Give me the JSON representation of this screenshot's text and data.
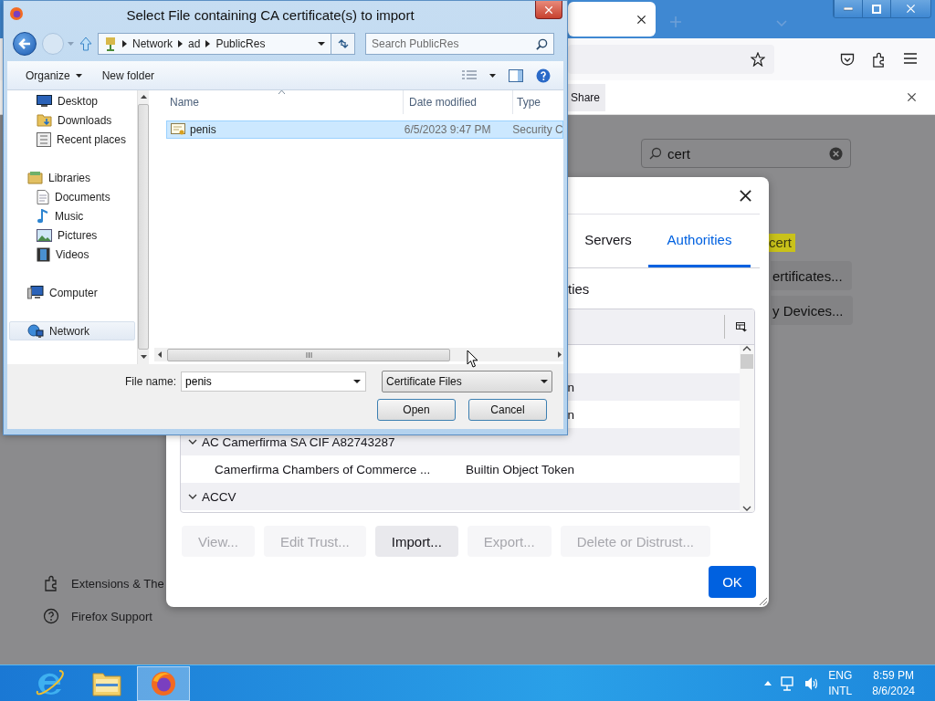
{
  "browser": {
    "notification": {
      "button": "Share"
    },
    "search": {
      "value": "cert"
    },
    "results": {
      "highlight": "cert",
      "buttons": [
        "ertificates...",
        "y Devices..."
      ]
    },
    "sidebar": [
      {
        "kind": "extensions",
        "label": "Extensions & The"
      },
      {
        "kind": "support",
        "label": "Firefox Support"
      }
    ]
  },
  "cert_dialog": {
    "tabs": [
      {
        "label": "Servers",
        "selected": false
      },
      {
        "label": "Authorities",
        "selected": true
      }
    ],
    "description": "ties",
    "rows": [
      {
        "kind": "cert",
        "token": "n"
      },
      {
        "kind": "cert",
        "token": "n"
      },
      {
        "kind": "group",
        "name": "AC Camerfirma SA CIF A82743287",
        "expanded": true
      },
      {
        "kind": "cert",
        "name": "Camerfirma Chambers of Commerce ...",
        "token": "Builtin Object Token"
      },
      {
        "kind": "group",
        "name": "ACCV",
        "expanded": true
      }
    ],
    "buttons": [
      {
        "label": "View...",
        "disabled": true
      },
      {
        "label": "Edit Trust...",
        "disabled": true
      },
      {
        "label": "Import...",
        "disabled": false
      },
      {
        "label": "Export...",
        "disabled": true
      },
      {
        "label": "Delete or Distrust...",
        "disabled": true
      }
    ],
    "ok": "OK"
  },
  "file_dialog": {
    "title": "Select File containing CA certificate(s) to import",
    "path": [
      "Network",
      "ad",
      "PublicRes"
    ],
    "search": {
      "placeholder": "Search PublicRes"
    },
    "toolbar": [
      "Organize",
      "New folder"
    ],
    "nav": [
      {
        "children": [
          {
            "kind": "desktop",
            "label": "Desktop",
            "selected": false
          },
          {
            "kind": "downloads",
            "label": "Downloads",
            "selected": false
          },
          {
            "kind": "recent",
            "label": "Recent places",
            "selected": false
          }
        ]
      },
      {
        "kind": "library",
        "label": "Libraries",
        "selected": false,
        "children": [
          {
            "kind": "documents",
            "label": "Documents",
            "selected": false
          },
          {
            "kind": "music",
            "label": "Music",
            "selected": false
          },
          {
            "kind": "pictures",
            "label": "Pictures",
            "selected": false
          },
          {
            "kind": "videos",
            "label": "Videos",
            "selected": false
          }
        ]
      },
      {
        "kind": "computer",
        "label": "Computer",
        "selected": false
      },
      {
        "kind": "network",
        "label": "Network",
        "selected": true
      }
    ],
    "columns": [
      "Name",
      "Date modified",
      "Type"
    ],
    "files": [
      {
        "name": "penis",
        "date": "6/5/2023 9:47 PM",
        "type": "Security C",
        "selected": true
      }
    ],
    "file_name_label": "File name:",
    "file_name": "penis",
    "file_type": "Certificate Files",
    "buttons": [
      "Open",
      "Cancel"
    ]
  },
  "taskbar": {
    "apps": [
      {
        "kind": "ie",
        "active": false
      },
      {
        "kind": "explorer",
        "active": false
      },
      {
        "kind": "firefox",
        "active": true
      }
    ],
    "language": [
      "ENG",
      "INTL"
    ],
    "time": "8:59 PM",
    "date": "8/6/2024"
  }
}
